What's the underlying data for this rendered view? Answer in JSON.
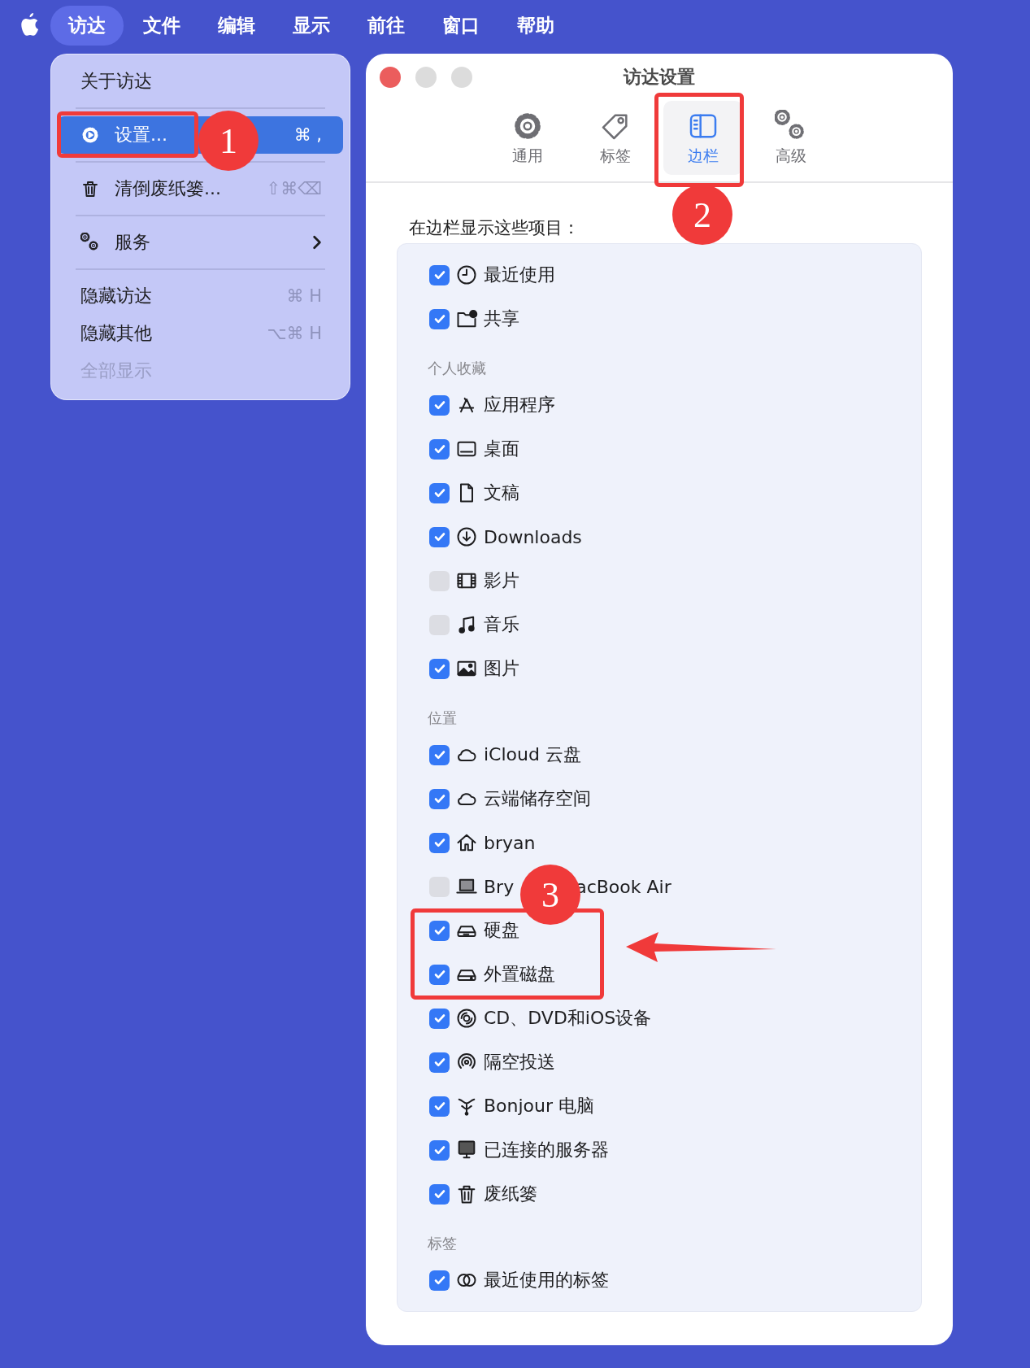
{
  "menu_bar": {
    "items": [
      {
        "label": "访达",
        "selected": true
      },
      {
        "label": "文件",
        "selected": false
      },
      {
        "label": "编辑",
        "selected": false
      },
      {
        "label": "显示",
        "selected": false
      },
      {
        "label": "前往",
        "selected": false
      },
      {
        "label": "窗口",
        "selected": false
      },
      {
        "label": "帮助",
        "selected": false
      }
    ]
  },
  "app_menu": {
    "items": [
      {
        "kind": "item",
        "label": "关于访达",
        "selected": false,
        "disabled": false
      },
      {
        "kind": "separator"
      },
      {
        "kind": "item",
        "label": "设置...",
        "shortcut": "⌘ ,",
        "selected": true,
        "disabled": false,
        "boxed": true,
        "callout": "1"
      },
      {
        "kind": "separator"
      },
      {
        "kind": "item",
        "label": "清倒废纸篓...",
        "shortcut": "⇧⌘⌫",
        "selected": false,
        "disabled": false
      },
      {
        "kind": "separator"
      },
      {
        "kind": "item",
        "label": "服务",
        "selected": false,
        "disabled": false,
        "submenu": true
      },
      {
        "kind": "separator"
      },
      {
        "kind": "item",
        "label": "隐藏访达",
        "shortcut": "⌘ H",
        "selected": false,
        "disabled": false
      },
      {
        "kind": "item",
        "label": "隐藏其他",
        "shortcut": "⌥⌘ H",
        "selected": false,
        "disabled": false
      },
      {
        "kind": "item",
        "label": "全部显示",
        "selected": false,
        "disabled": true
      }
    ]
  },
  "settings_window": {
    "title": "访达设置",
    "tabs": [
      {
        "label": "通用",
        "selected": false
      },
      {
        "label": "标签",
        "selected": false
      },
      {
        "label": "边栏",
        "selected": true,
        "boxed": true,
        "callout": "2"
      },
      {
        "label": "高级",
        "selected": false
      }
    ],
    "intro": "在边栏显示这些项目：",
    "callout": "3",
    "sections": [
      {
        "items": [
          {
            "label": "最近使用",
            "checked": true
          },
          {
            "label": "共享",
            "checked": true
          }
        ]
      },
      {
        "header": "个人收藏",
        "items": [
          {
            "label": "应用程序",
            "checked": true
          },
          {
            "label": "桌面",
            "checked": true
          },
          {
            "label": "文稿",
            "checked": true
          },
          {
            "label": "Downloads",
            "checked": true
          },
          {
            "label": "影片",
            "checked": false
          },
          {
            "label": "音乐",
            "checked": false
          },
          {
            "label": "图片",
            "checked": true
          }
        ]
      },
      {
        "header": "位置",
        "items": [
          {
            "label": "iCloud 云盘",
            "checked": true
          },
          {
            "label": "云端储存空间",
            "checked": true
          },
          {
            "label": "bryan",
            "checked": true
          },
          {
            "label_parts": [
              "Bry",
              "acBook Air"
            ],
            "checked": false
          },
          {
            "label": "硬盘",
            "checked": true,
            "boxed": true
          },
          {
            "label": "外置磁盘",
            "checked": true,
            "boxed": true
          },
          {
            "label": "CD、DVD和iOS设备",
            "checked": true
          },
          {
            "label": "隔空投送",
            "checked": true
          },
          {
            "label": "Bonjour 电脑",
            "checked": true
          },
          {
            "label": "已连接的服务器",
            "checked": true
          },
          {
            "label": "废纸篓",
            "checked": true
          }
        ]
      },
      {
        "header": "标签",
        "items": [
          {
            "label": "最近使用的标签",
            "checked": true
          }
        ]
      }
    ]
  }
}
